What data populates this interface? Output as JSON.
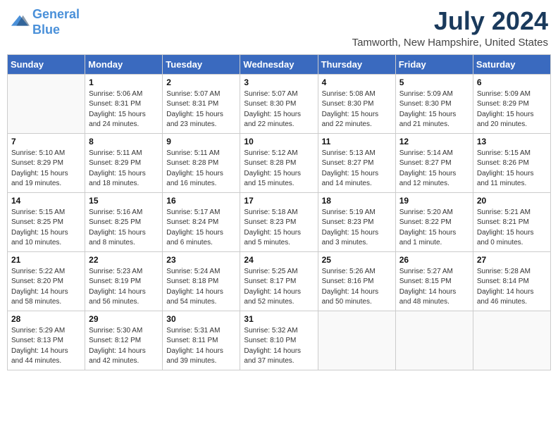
{
  "header": {
    "logo_line1": "General",
    "logo_line2": "Blue",
    "month_year": "July 2024",
    "location": "Tamworth, New Hampshire, United States"
  },
  "weekdays": [
    "Sunday",
    "Monday",
    "Tuesday",
    "Wednesday",
    "Thursday",
    "Friday",
    "Saturday"
  ],
  "weeks": [
    [
      {
        "day": "",
        "info": ""
      },
      {
        "day": "1",
        "info": "Sunrise: 5:06 AM\nSunset: 8:31 PM\nDaylight: 15 hours\nand 24 minutes."
      },
      {
        "day": "2",
        "info": "Sunrise: 5:07 AM\nSunset: 8:31 PM\nDaylight: 15 hours\nand 23 minutes."
      },
      {
        "day": "3",
        "info": "Sunrise: 5:07 AM\nSunset: 8:30 PM\nDaylight: 15 hours\nand 22 minutes."
      },
      {
        "day": "4",
        "info": "Sunrise: 5:08 AM\nSunset: 8:30 PM\nDaylight: 15 hours\nand 22 minutes."
      },
      {
        "day": "5",
        "info": "Sunrise: 5:09 AM\nSunset: 8:30 PM\nDaylight: 15 hours\nand 21 minutes."
      },
      {
        "day": "6",
        "info": "Sunrise: 5:09 AM\nSunset: 8:29 PM\nDaylight: 15 hours\nand 20 minutes."
      }
    ],
    [
      {
        "day": "7",
        "info": "Sunrise: 5:10 AM\nSunset: 8:29 PM\nDaylight: 15 hours\nand 19 minutes."
      },
      {
        "day": "8",
        "info": "Sunrise: 5:11 AM\nSunset: 8:29 PM\nDaylight: 15 hours\nand 18 minutes."
      },
      {
        "day": "9",
        "info": "Sunrise: 5:11 AM\nSunset: 8:28 PM\nDaylight: 15 hours\nand 16 minutes."
      },
      {
        "day": "10",
        "info": "Sunrise: 5:12 AM\nSunset: 8:28 PM\nDaylight: 15 hours\nand 15 minutes."
      },
      {
        "day": "11",
        "info": "Sunrise: 5:13 AM\nSunset: 8:27 PM\nDaylight: 15 hours\nand 14 minutes."
      },
      {
        "day": "12",
        "info": "Sunrise: 5:14 AM\nSunset: 8:27 PM\nDaylight: 15 hours\nand 12 minutes."
      },
      {
        "day": "13",
        "info": "Sunrise: 5:15 AM\nSunset: 8:26 PM\nDaylight: 15 hours\nand 11 minutes."
      }
    ],
    [
      {
        "day": "14",
        "info": "Sunrise: 5:15 AM\nSunset: 8:25 PM\nDaylight: 15 hours\nand 10 minutes."
      },
      {
        "day": "15",
        "info": "Sunrise: 5:16 AM\nSunset: 8:25 PM\nDaylight: 15 hours\nand 8 minutes."
      },
      {
        "day": "16",
        "info": "Sunrise: 5:17 AM\nSunset: 8:24 PM\nDaylight: 15 hours\nand 6 minutes."
      },
      {
        "day": "17",
        "info": "Sunrise: 5:18 AM\nSunset: 8:23 PM\nDaylight: 15 hours\nand 5 minutes."
      },
      {
        "day": "18",
        "info": "Sunrise: 5:19 AM\nSunset: 8:23 PM\nDaylight: 15 hours\nand 3 minutes."
      },
      {
        "day": "19",
        "info": "Sunrise: 5:20 AM\nSunset: 8:22 PM\nDaylight: 15 hours\nand 1 minute."
      },
      {
        "day": "20",
        "info": "Sunrise: 5:21 AM\nSunset: 8:21 PM\nDaylight: 15 hours\nand 0 minutes."
      }
    ],
    [
      {
        "day": "21",
        "info": "Sunrise: 5:22 AM\nSunset: 8:20 PM\nDaylight: 14 hours\nand 58 minutes."
      },
      {
        "day": "22",
        "info": "Sunrise: 5:23 AM\nSunset: 8:19 PM\nDaylight: 14 hours\nand 56 minutes."
      },
      {
        "day": "23",
        "info": "Sunrise: 5:24 AM\nSunset: 8:18 PM\nDaylight: 14 hours\nand 54 minutes."
      },
      {
        "day": "24",
        "info": "Sunrise: 5:25 AM\nSunset: 8:17 PM\nDaylight: 14 hours\nand 52 minutes."
      },
      {
        "day": "25",
        "info": "Sunrise: 5:26 AM\nSunset: 8:16 PM\nDaylight: 14 hours\nand 50 minutes."
      },
      {
        "day": "26",
        "info": "Sunrise: 5:27 AM\nSunset: 8:15 PM\nDaylight: 14 hours\nand 48 minutes."
      },
      {
        "day": "27",
        "info": "Sunrise: 5:28 AM\nSunset: 8:14 PM\nDaylight: 14 hours\nand 46 minutes."
      }
    ],
    [
      {
        "day": "28",
        "info": "Sunrise: 5:29 AM\nSunset: 8:13 PM\nDaylight: 14 hours\nand 44 minutes."
      },
      {
        "day": "29",
        "info": "Sunrise: 5:30 AM\nSunset: 8:12 PM\nDaylight: 14 hours\nand 42 minutes."
      },
      {
        "day": "30",
        "info": "Sunrise: 5:31 AM\nSunset: 8:11 PM\nDaylight: 14 hours\nand 39 minutes."
      },
      {
        "day": "31",
        "info": "Sunrise: 5:32 AM\nSunset: 8:10 PM\nDaylight: 14 hours\nand 37 minutes."
      },
      {
        "day": "",
        "info": ""
      },
      {
        "day": "",
        "info": ""
      },
      {
        "day": "",
        "info": ""
      }
    ]
  ]
}
